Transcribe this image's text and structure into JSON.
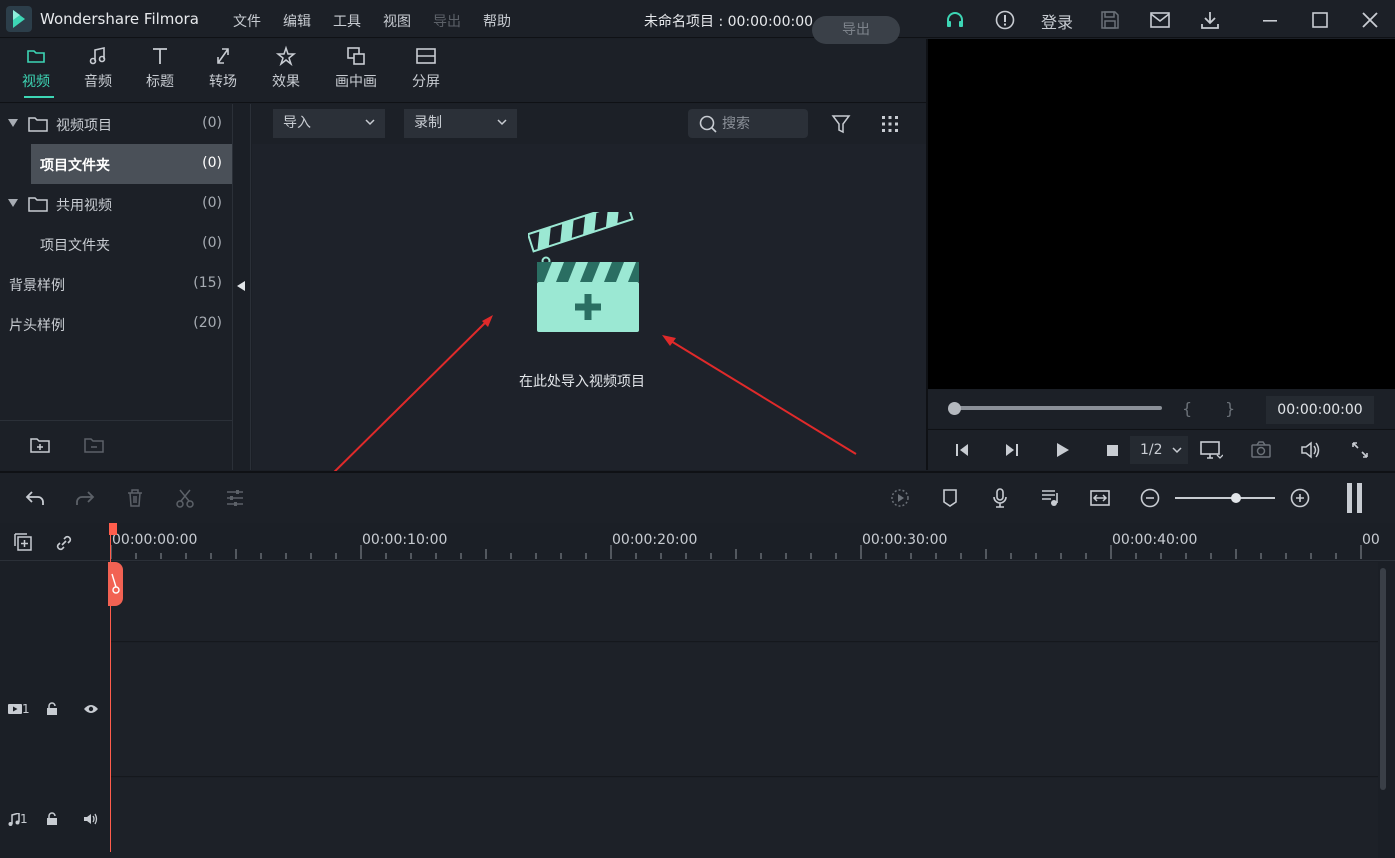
{
  "app": {
    "name": "Wondershare Filmora",
    "project_title": "未命名项目 : 00:00:00:00",
    "login_label": "登录"
  },
  "menu": [
    "文件",
    "编辑",
    "工具",
    "视图",
    "导出",
    "帮助"
  ],
  "media_tabs": [
    {
      "label": "视频",
      "icon": "folder-icon",
      "active": true
    },
    {
      "label": "音频",
      "icon": "music-note-icon"
    },
    {
      "label": "标题",
      "icon": "text-t-icon"
    },
    {
      "label": "转场",
      "icon": "transition-icon"
    },
    {
      "label": "效果",
      "icon": "effects-icon"
    },
    {
      "label": "画中画",
      "icon": "pip-icon"
    },
    {
      "label": "分屏",
      "icon": "split-screen-icon"
    }
  ],
  "export_button": "导出",
  "tree": [
    {
      "name": "视频项目",
      "count": "(0)"
    },
    {
      "name": "项目文件夹",
      "count": "(0)"
    },
    {
      "name": "共用视频",
      "count": "(0)"
    },
    {
      "name": "项目文件夹",
      "count": "(0)"
    },
    {
      "name": "背景样例",
      "count": "(15)"
    },
    {
      "name": "片头样例",
      "count": "(20)"
    }
  ],
  "media_toolbar": {
    "import_label": "导入",
    "record_label": "录制",
    "search_placeholder": "搜索"
  },
  "import_hint": "在此处导入视频项目",
  "preview": {
    "time": "00:00:00:00",
    "ratio": "1/2",
    "in_mark": "{",
    "out_mark": "}"
  },
  "ruler_ticks": [
    "00:00:00:00",
    "00:00:10:00",
    "00:00:20:00",
    "00:00:30:00",
    "00:00:40:00",
    "00"
  ],
  "tracks": {
    "video_label": "1",
    "audio_label": "1"
  },
  "colors": {
    "accent": "#3dd6b5",
    "playhead": "#ff5d4c",
    "clapper": "#9be8d3"
  }
}
